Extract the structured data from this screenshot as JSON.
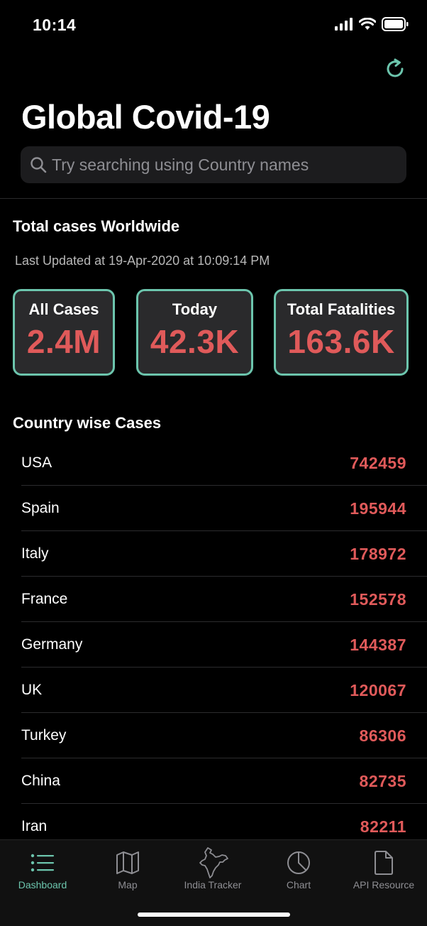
{
  "status_bar": {
    "time": "10:14"
  },
  "header": {
    "title": "Global Covid-19"
  },
  "search": {
    "placeholder": "Try searching using Country names"
  },
  "worldwide": {
    "section_title": "Total cases Worldwide",
    "last_updated": "Last Updated at 19-Apr-2020 at 10:09:14 PM",
    "cards": [
      {
        "label": "All Cases",
        "value": "2.4M"
      },
      {
        "label": "Today",
        "value": "42.3K"
      },
      {
        "label": "Total Fatalities",
        "value": "163.6K"
      }
    ]
  },
  "countries": {
    "section_title": "Country wise Cases",
    "rows": [
      {
        "name": "USA",
        "cases": "742459"
      },
      {
        "name": "Spain",
        "cases": "195944"
      },
      {
        "name": "Italy",
        "cases": "178972"
      },
      {
        "name": "France",
        "cases": "152578"
      },
      {
        "name": "Germany",
        "cases": "144387"
      },
      {
        "name": "UK",
        "cases": "120067"
      },
      {
        "name": "Turkey",
        "cases": "86306"
      },
      {
        "name": "China",
        "cases": "82735"
      },
      {
        "name": "Iran",
        "cases": "82211"
      }
    ]
  },
  "tabs": [
    {
      "label": "Dashboard",
      "icon": "list-icon",
      "active": true
    },
    {
      "label": "Map",
      "icon": "map-icon"
    },
    {
      "label": "India Tracker",
      "icon": "india-map-icon"
    },
    {
      "label": "Chart",
      "icon": "pie-chart-icon"
    },
    {
      "label": "API Resource",
      "icon": "document-icon"
    }
  ],
  "colors": {
    "accent": "#6cc5ad",
    "danger": "#e05a5a",
    "background": "#000000",
    "card": "#2a2a2c"
  }
}
